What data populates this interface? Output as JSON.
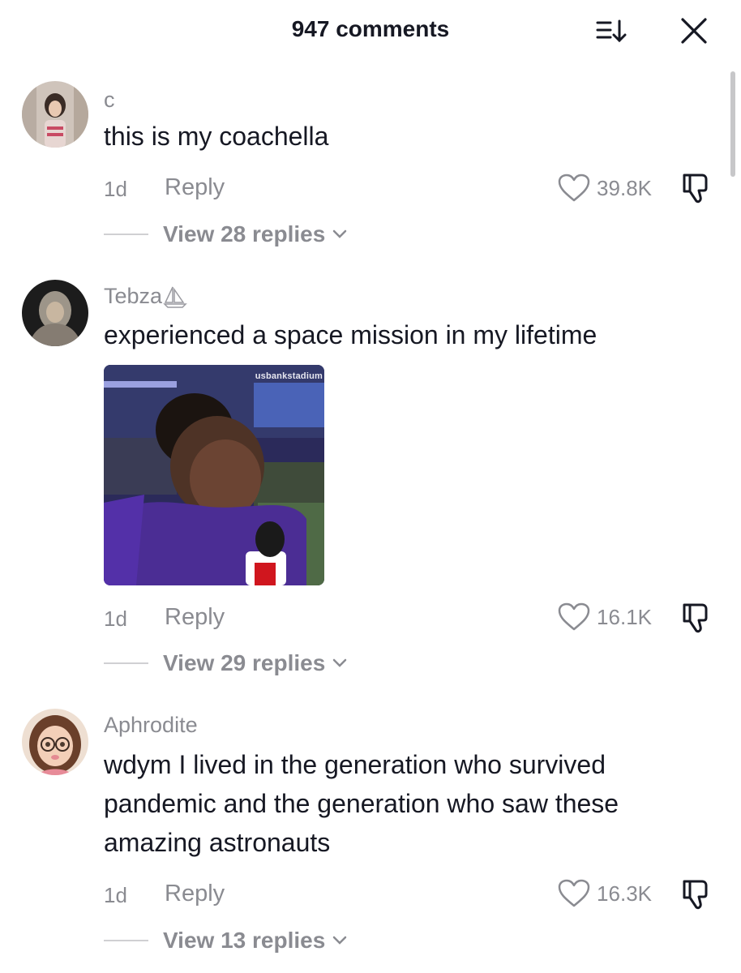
{
  "header": {
    "title": "947 comments",
    "sort_icon": "sort-icon",
    "close_icon": "close-icon"
  },
  "comments": [
    {
      "username": "c",
      "text": "this is my coachella",
      "time": "1d",
      "reply_label": "Reply",
      "likes": "39.8K",
      "view_replies": "View 28 replies"
    },
    {
      "username": "Tebza",
      "text": "experienced a space mission in my lifetime",
      "media_watermark": "usbankstadium",
      "time": "1d",
      "reply_label": "Reply",
      "likes": "16.1K",
      "view_replies": "View 29 replies"
    },
    {
      "username": "Aphrodite",
      "text": "wdym I lived in the generation who survived pandemic and the generation who saw these amazing astronauts",
      "time": "1d",
      "reply_label": "Reply",
      "likes": "16.3K",
      "view_replies": "View 13 replies"
    }
  ],
  "colors": {
    "primary_text": "#161823",
    "secondary_text": "#8a8b91",
    "background": "#ffffff"
  }
}
